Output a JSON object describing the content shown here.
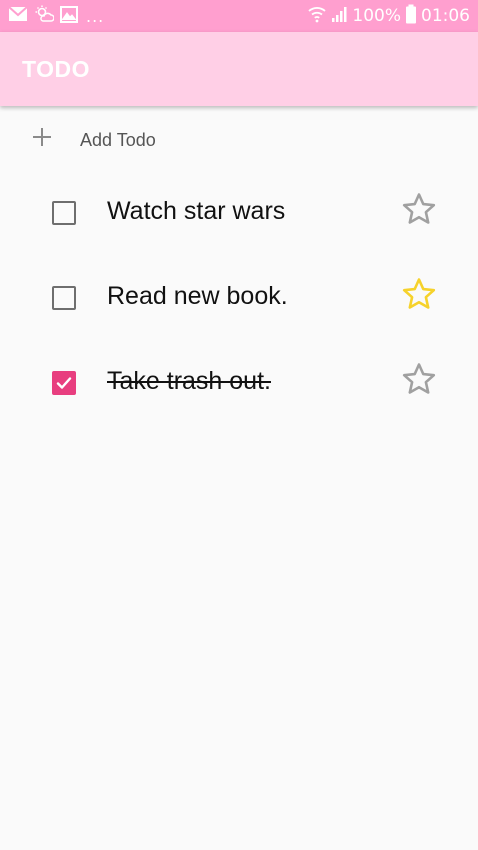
{
  "status_bar": {
    "notification_icons": [
      "mail-icon",
      "weather-icon",
      "gallery-icon"
    ],
    "overflow": "...",
    "battery_percent": "100%",
    "time": "01:06",
    "colors": {
      "background": "#ff9fcf"
    }
  },
  "app_bar": {
    "title": "TODO",
    "colors": {
      "background": "#ffcfe6"
    }
  },
  "add_todo": {
    "label": "Add Todo",
    "icon": "plus-icon"
  },
  "todos": [
    {
      "text": "Watch star wars",
      "completed": false,
      "starred": false
    },
    {
      "text": "Read new book.",
      "completed": false,
      "starred": true
    },
    {
      "text": "Take trash out.",
      "completed": true,
      "starred": false
    }
  ],
  "colors": {
    "accent": "#e83e7f",
    "star_filled": "#f6d22b",
    "star_empty": "#a0a0a0"
  }
}
